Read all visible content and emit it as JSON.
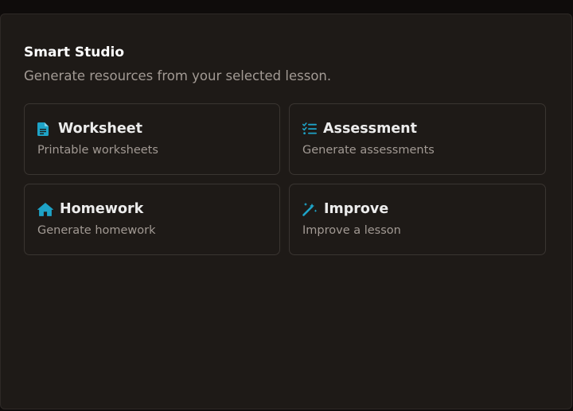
{
  "panel": {
    "title": "Smart Studio",
    "subtitle": "Generate resources from your selected lesson."
  },
  "accent_color": "#1ea3c7",
  "cards": [
    {
      "title": "Worksheet",
      "description": "Printable worksheets",
      "icon": "document-icon"
    },
    {
      "title": "Assessment",
      "description": "Generate assessments",
      "icon": "checklist-icon"
    },
    {
      "title": "Homework",
      "description": "Generate homework",
      "icon": "home-icon"
    },
    {
      "title": "Improve",
      "description": "Improve a lesson",
      "icon": "magic-wand-icon"
    }
  ]
}
